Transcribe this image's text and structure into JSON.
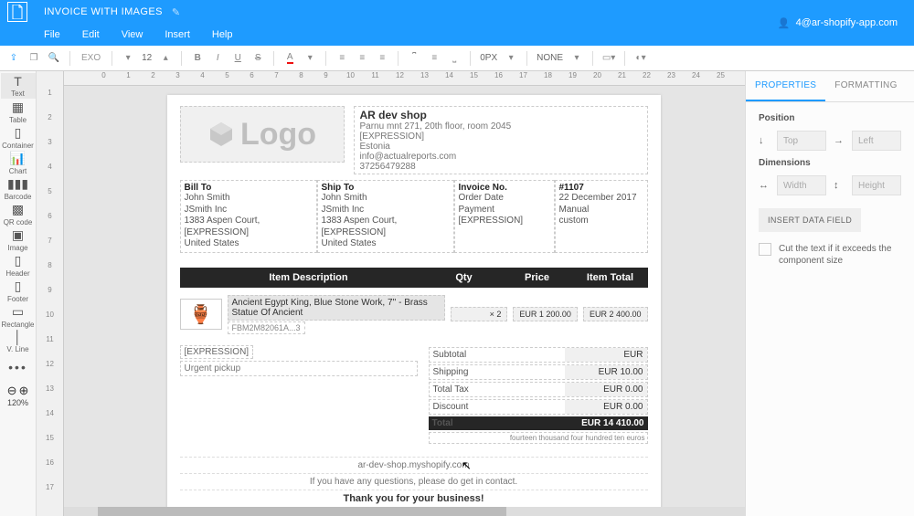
{
  "header": {
    "doc_title": "INVOICE WITH IMAGES",
    "user": "4@ar-shopify-app.com",
    "menus": [
      "File",
      "Edit",
      "View",
      "Insert",
      "Help"
    ]
  },
  "toolbar": {
    "font": "EXO",
    "font_size": "12",
    "spacing": "0PX",
    "border": "NONE"
  },
  "left_tools": {
    "text": "Text",
    "table": "Table",
    "container": "Container",
    "chart": "Chart",
    "barcode": "Barcode",
    "qrcode": "QR code",
    "image": "Image",
    "header_t": "Header",
    "footer": "Footer",
    "rectangle": "Rectangle",
    "vline": "V. Line",
    "zoom": "120%"
  },
  "hruler": [
    "0",
    "1",
    "2",
    "3",
    "4",
    "5",
    "6",
    "7",
    "8",
    "9",
    "10",
    "11",
    "12",
    "13",
    "14",
    "15",
    "16",
    "17",
    "18",
    "19",
    "20",
    "21",
    "22",
    "23",
    "24",
    "25"
  ],
  "vruler": [
    "1",
    "2",
    "3",
    "4",
    "5",
    "6",
    "7",
    "8",
    "9",
    "10",
    "11",
    "12",
    "13",
    "14",
    "15",
    "16",
    "17"
  ],
  "company": {
    "name": "AR dev shop",
    "addr": "Parnu mnt 271, 20th floor, room 2045",
    "expr": "[EXPRESSION]",
    "country": "Estonia",
    "email": "info@actualreports.com",
    "phone": "37256479288"
  },
  "bill_to": {
    "title": "Bill To",
    "name": "John Smith",
    "company": "JSmith Inc",
    "addr": "1383 Aspen Court,",
    "expr": "[EXPRESSION]",
    "country": "United States"
  },
  "ship_to": {
    "title": "Ship To",
    "name": "John Smith",
    "company": "JSmith Inc",
    "addr": "1383 Aspen Court,",
    "expr": "[EXPRESSION]",
    "country": "United States"
  },
  "meta_labels": {
    "invoice_no": "Invoice No.",
    "order_date": "Order Date",
    "payment": "Payment",
    "expr": "[EXPRESSION]"
  },
  "meta_vals": {
    "invoice_no": "#1107",
    "order_date": "22 December 2017",
    "payment": "Manual",
    "expr": "custom"
  },
  "table_hdr": {
    "desc": "Item Description",
    "qty": "Qty",
    "price": "Price",
    "total": "Item Total"
  },
  "line": {
    "desc": "Ancient Egypt King, Blue Stone Work, 7'' - Brass Statue Of Ancient",
    "sku": "FBM2M82061A...3",
    "qty": "× 2",
    "price": "EUR 1 200.00",
    "total": "EUR 2 400.00"
  },
  "notes": {
    "expr": "[EXPRESSION]",
    "text": "Urgent pickup"
  },
  "totals": {
    "subtotal_l": "Subtotal",
    "subtotal_v": "EUR",
    "shipping_l": "Shipping",
    "shipping_v": "EUR 10.00",
    "tax_l": "Total Tax",
    "tax_v": "EUR 0.00",
    "discount_l": "Discount",
    "discount_v": "EUR 0.00",
    "total_l": "Total",
    "total_v": "EUR 14 410.00",
    "words": "fourteen thousand four hundred ten euros"
  },
  "footer": {
    "url": "ar-dev-shop.myshopify.com",
    "contact": "If you have any questions, please do get in contact.",
    "thanks": "Thank you for your business!"
  },
  "right": {
    "tab_props": "PROPERTIES",
    "tab_fmt": "FORMATTING",
    "position": "Position",
    "top": "Top",
    "left": "Left",
    "dimensions": "Dimensions",
    "width": "Width",
    "height": "Height",
    "insert_btn": "INSERT DATA FIELD",
    "cut_text": "Cut the text if it exceeds the component size"
  }
}
